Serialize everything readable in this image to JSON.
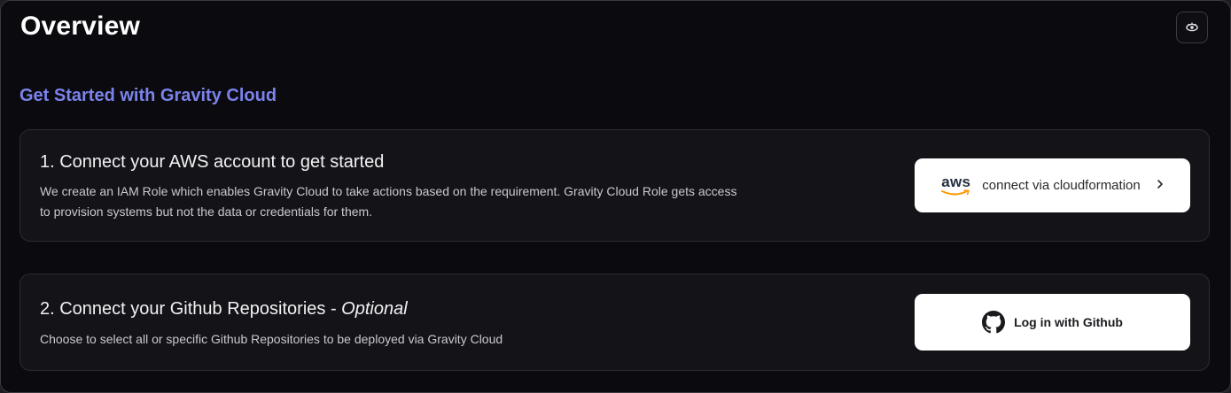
{
  "header": {
    "title": "Overview",
    "settings_icon": "eye-settings-icon"
  },
  "section": {
    "title": "Get Started with Gravity Cloud"
  },
  "steps": [
    {
      "title": "1. Connect your AWS account to get started",
      "description": "We create an IAM Role which enables Gravity Cloud to take actions based on the requirement. Gravity Cloud Role gets access to provision systems but not the data or credentials for them.",
      "button": {
        "logo_text": "aws",
        "label": "connect via cloudformation",
        "icon": "chevron-right-icon"
      }
    },
    {
      "title": "2. Connect your Github Repositories - ",
      "title_emphasis": "Optional",
      "description": "Choose to select all or specific Github Repositories to be deployed via Gravity Cloud",
      "button": {
        "label": "Log in with Github",
        "icon": "github-icon"
      }
    }
  ],
  "colors": {
    "background": "#0b0a0f",
    "card": "#141318",
    "accent": "#7b83eb",
    "aws_orange": "#ff9900"
  }
}
